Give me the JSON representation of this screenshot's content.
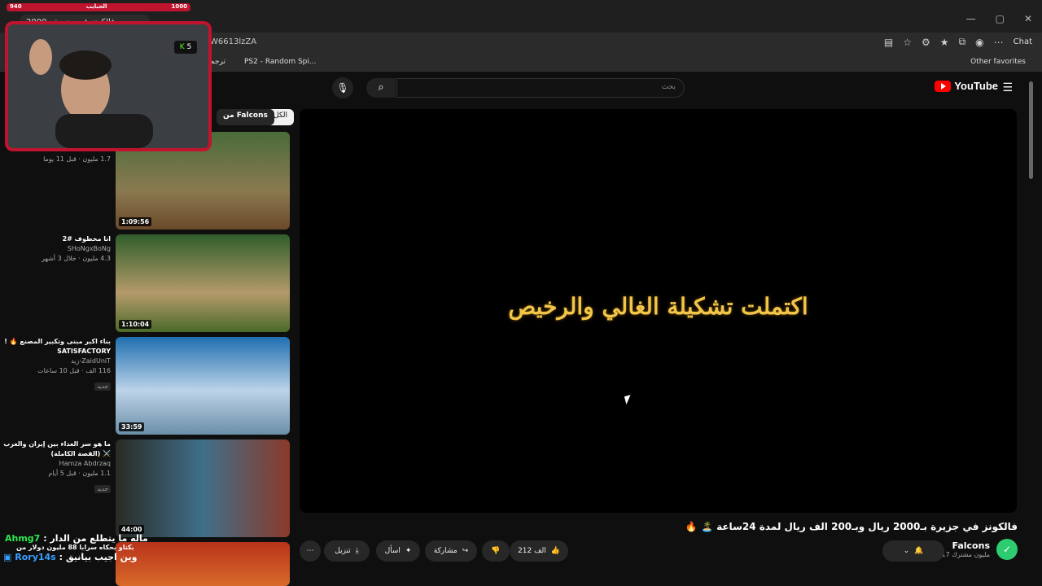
{
  "stream": {
    "goal_left": "940",
    "goal_label": "الحبايب",
    "goal_right": "1000",
    "kick_count": "5"
  },
  "browser": {
    "tab_title": "فالكونز في جزيرة بـ2000",
    "url": "W6613lzZA",
    "chat_label": "Chat",
    "bookmark_1": "PS2 - Random Spi...",
    "bookmark_2": "ترجم",
    "other_favorites": "Other favorites"
  },
  "header": {
    "logo_text": "YouTube",
    "logo_region": "JO",
    "search_placeholder": "بحث"
  },
  "player": {
    "overlay_text": "اكتملت تشكيلة الغالي والرخيص",
    "title": "فالكونز في جزيرة بـ2000 ريال وبـ200 الف ريال لمدة 24ساعة 🏝️ 🔥"
  },
  "channel": {
    "name": "Falcons",
    "subscribers": "4.17 مليون مشترك"
  },
  "actions": {
    "likes": "212 الف",
    "share": "مشاركة",
    "ask": "اسأل",
    "download": "تنزيل"
  },
  "sidebar": {
    "chip_all": "الكل",
    "chip_from": "من Falcons",
    "videos": [
      {
        "title": "",
        "channel": "",
        "meta": "1.7 مليون · قبل 11 يوما",
        "duration": "1:09:56",
        "new": ""
      },
      {
        "title": "انا مخطوف #2",
        "channel": "SHoNgxBoNg",
        "meta": "4.3 مليون · خلال 3 أشهر",
        "duration": "1:10:04",
        "new": ""
      },
      {
        "title": "بناء اكبر مبنى وتكبير المصنع 🔥 ! SATISFACTORY",
        "channel": "ZaidUniT-زيد",
        "meta": "116 الف · قبل 10 ساعات",
        "duration": "33:59",
        "new": "جديد"
      },
      {
        "title": "ما هو سر العداء بين إيران والعرب ⚔️ (القصة الكاملة)",
        "channel": "Hamza Abdrzaq",
        "meta": "1.1 مليون · قبل 5 أيام",
        "duration": "44:00",
        "new": "جديد"
      }
    ]
  },
  "chat": {
    "line1_user": "Ahmg7",
    "line1_text": ": ماله ما يتطلع من الدار",
    "line2_text": "بكتاو بحكاه سرابا 88 مليون دولار من",
    "line3_user": "Rory14s",
    "line3_text": ": وين اجيب بيانيق"
  },
  "colors": {
    "accent_red": "#c0142e",
    "yt_red": "#ff0000",
    "overlay_gold": "#f1c44a",
    "chat_green": "#2ee84e",
    "chat_blue": "#3aa0ff"
  }
}
